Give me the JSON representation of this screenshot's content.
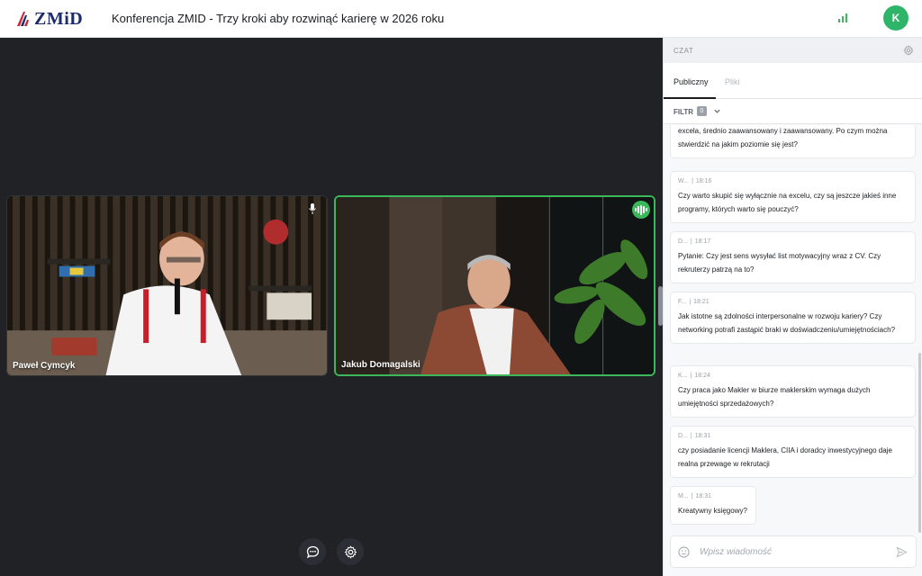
{
  "brand": {
    "name": "ZMiD",
    "colors": {
      "brand_blue": "#1c2b6b",
      "brand_red": "#c8283c",
      "accent_green": "#3bb85a"
    }
  },
  "header": {
    "title": "Konferencja ZMID - Trzy kroki aby rozwinąć karierę w 2026 roku",
    "avatar_initial": "K"
  },
  "stage": {
    "tiles": [
      {
        "name": "Paweł Cymcyk",
        "status_icon": "mic-icon"
      },
      {
        "name": "Jakub Domagalski",
        "status_icon": "speaking-icon"
      }
    ],
    "controls": [
      {
        "icon": "chat-bubble-icon"
      },
      {
        "icon": "gear-icon"
      }
    ]
  },
  "chat": {
    "title": "CZAT",
    "tabs": [
      "Publiczny",
      "Pliki"
    ],
    "filter": {
      "label": "FILTR",
      "count": "0"
    },
    "messages": [
      {
        "author": "",
        "time": "",
        "text": "excela, średnio zaawansowany i zaawansowany. Po czym można stwierdzić na jakim poziomie się jest?"
      },
      {
        "author": "W...",
        "time": "18:16",
        "text": "Czy warto skupić się wyłącznie na excelu, czy są jeszcze jakieś inne programy, których warto się pouczyć?"
      },
      {
        "author": "D...",
        "time": "18:17",
        "text": "Pytanie: Czy jest sens wysyłać list motywacyjny wraz z CV. Czy rekruterzy patrzą na to?"
      },
      {
        "author": "F...",
        "time": "18:21",
        "text": "Jak istotne są zdolności interpersonalne w rozwoju kariery? Czy networking potrafi zastąpić braki w doświadczeniu/umiejętnościach?"
      },
      {
        "author": "K...",
        "time": "18:24",
        "text": "Czy praca jako Makler w biurze maklerskim wymaga dużych umiejętności sprzedażowych?"
      },
      {
        "author": "D...",
        "time": "18:31",
        "text": "czy posiadanie licencji Maklera, CIIA i doradcy inwestycyjnego daje realna przewage w rekrutacji"
      },
      {
        "author": "M...",
        "time": "18:31",
        "text": "Kreatywny księgowy?"
      }
    ],
    "composer": {
      "placeholder": "Wpisz wiadomość"
    }
  }
}
